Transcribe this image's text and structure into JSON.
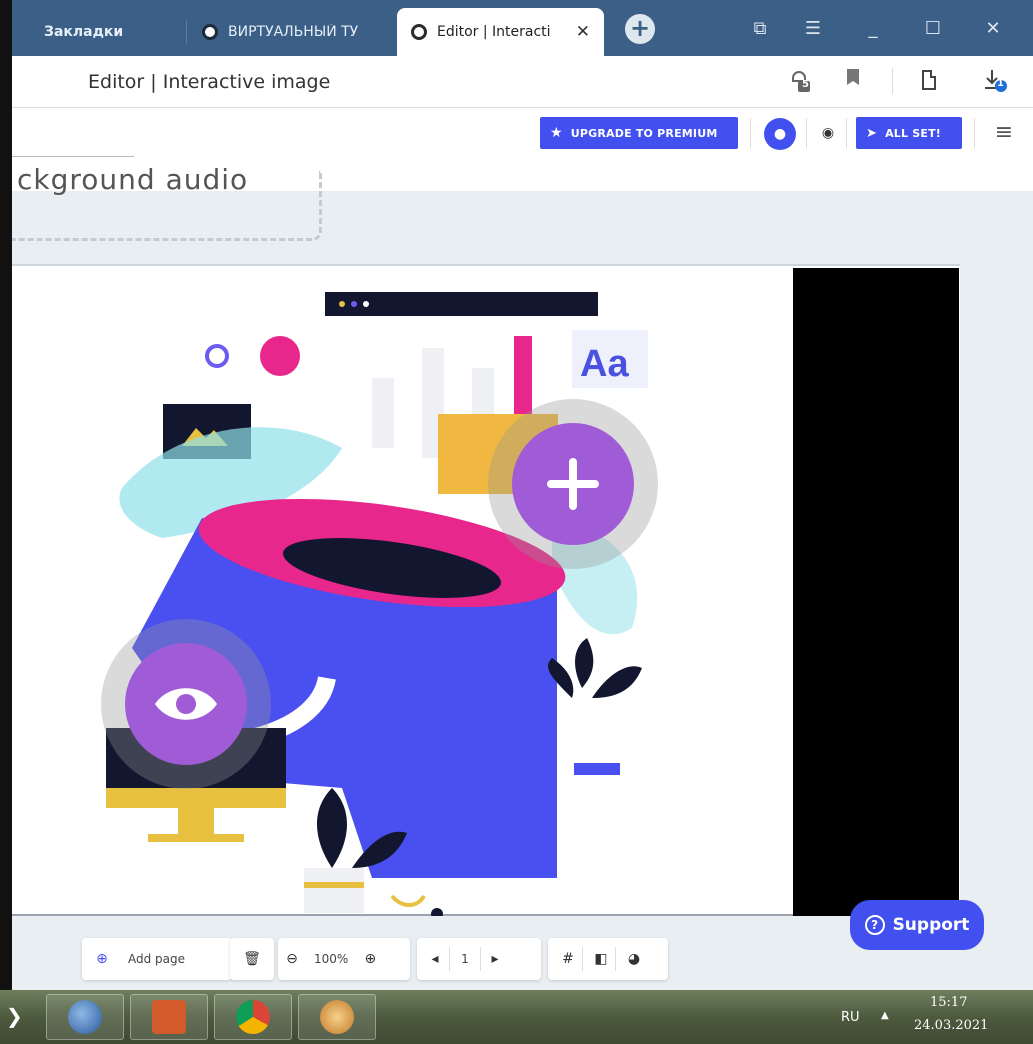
{
  "tabs": [
    {
      "label": "Закладки"
    },
    {
      "label": "ВИРТУАЛЬНЫЙ ТУ"
    },
    {
      "label": "Editor | Interacti"
    }
  ],
  "window_controls": {
    "minimize": "_",
    "maximize": "☐",
    "close": "✕"
  },
  "address": {
    "page_title": "Editor | Interactive image",
    "adblock_count": "5",
    "downloads_count": "1"
  },
  "header": {
    "upgrade_label": "UPGRADE TO PREMIUM",
    "allset_label": "ALL SET!"
  },
  "canvas": {
    "audio_label": "ckground audio",
    "sample_text": "Aa"
  },
  "support": {
    "label": "Support"
  },
  "toolbar": {
    "add_page": "Add page",
    "zoom": "100%",
    "page": "1"
  },
  "taskbar": {
    "lang": "RU",
    "time": "15:17",
    "date": "24.03.2021"
  },
  "colors": {
    "accent": "#4250f0",
    "hotspot": "#a05bd6",
    "tabbar": "#3b5f86"
  }
}
